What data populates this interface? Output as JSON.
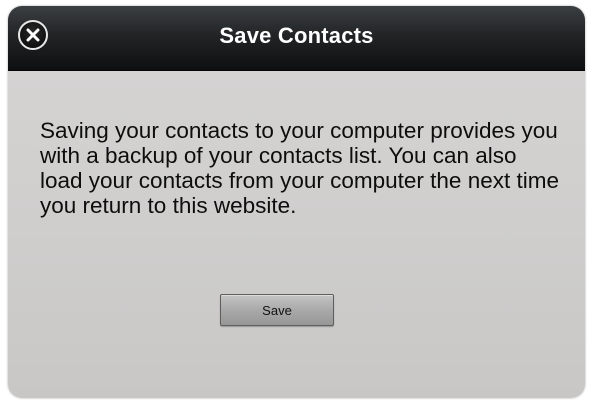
{
  "dialog": {
    "title": "Save Contacts",
    "close_icon": "close-icon",
    "message": "Saving your contacts to your computer provides you with a backup of your contacts list. You can also load your contacts from your computer the next time you return to this website.",
    "save_label": "Save"
  },
  "colors": {
    "titlebar": "#1a1b1c",
    "body": "#d0cfce",
    "title_text": "#ffffff",
    "button": "#a9a9a9"
  }
}
